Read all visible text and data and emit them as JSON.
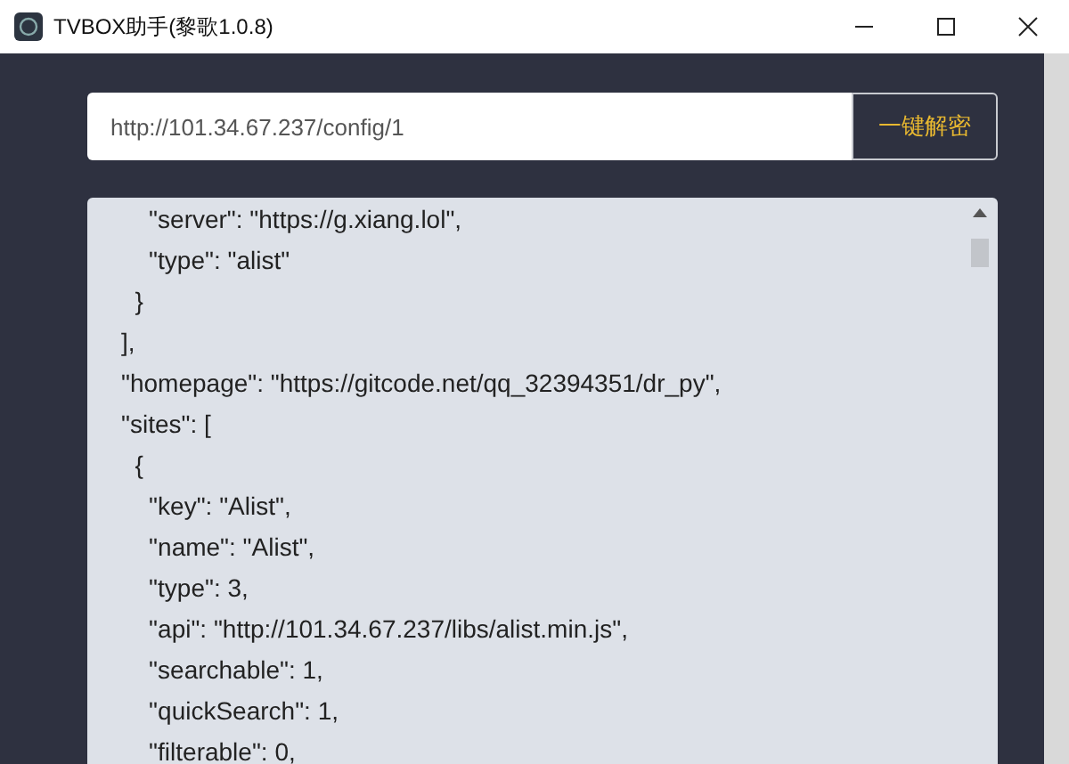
{
  "window": {
    "title": "TVBOX助手(黎歌1.0.8)"
  },
  "url_field": {
    "value": "http://101.34.67.237/config/1"
  },
  "decrypt_button": {
    "label": "一键解密"
  },
  "output": {
    "lines": [
      "    \"server\": \"https://g.xiang.lol\",",
      "    \"type\": \"alist\"",
      "  }",
      "],",
      "\"homepage\": \"https://gitcode.net/qq_32394351/dr_py\",",
      "\"sites\": [",
      "  {",
      "    \"key\": \"Alist\",",
      "    \"name\": \"Alist\",",
      "    \"type\": 3,",
      "    \"api\": \"http://101.34.67.237/libs/alist.min.js\",",
      "    \"searchable\": 1,",
      "    \"quickSearch\": 1,",
      "    \"filterable\": 0,"
    ]
  }
}
